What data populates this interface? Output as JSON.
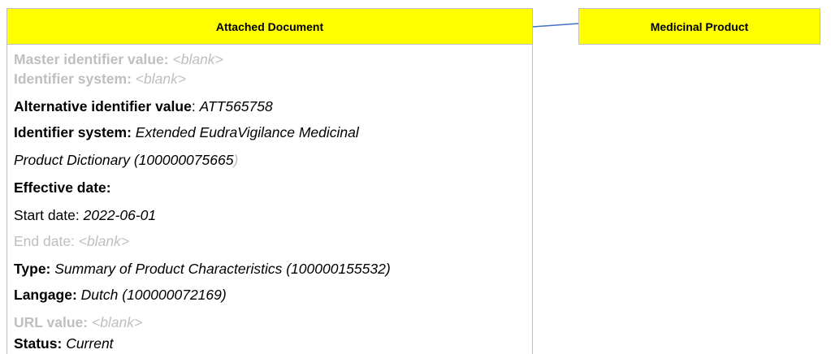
{
  "attached_document": {
    "title": "Attached Document",
    "lines": [
      {
        "label": "Master identifier value:",
        "value": "<blank>"
      },
      {
        "label": "Identifier system:",
        "value": "<blank>"
      },
      {
        "label": "Alternative identifier value",
        "sep": ":",
        "value": "ATT565758"
      },
      {
        "label": "Identifier system:",
        "value": "Extended EudraVigilance Medicinal"
      },
      {
        "value": "Product Dictionary (100000075665",
        "trail": ")"
      },
      {
        "label": "Effective date:"
      },
      {
        "label": "Start date:",
        "value": "2022-06-01"
      },
      {
        "label": "End date:",
        "value": "<blank>"
      },
      {
        "label": "Type:",
        "value": "Summary of Product Characteristics (100000155532)"
      },
      {
        "label": "Langage:",
        "value": "Dutch (100000072169)"
      },
      {
        "label": "URL value:",
        "value": "<blank>"
      },
      {
        "label": "Status:",
        "value": "Current"
      }
    ]
  },
  "medicinal_product": {
    "title": "Medicinal Product"
  },
  "colors": {
    "header_fill": "#ffff00",
    "box_border": "#bfbfbf",
    "connector": "#4472c4",
    "muted_text": "#bfbfbf"
  }
}
